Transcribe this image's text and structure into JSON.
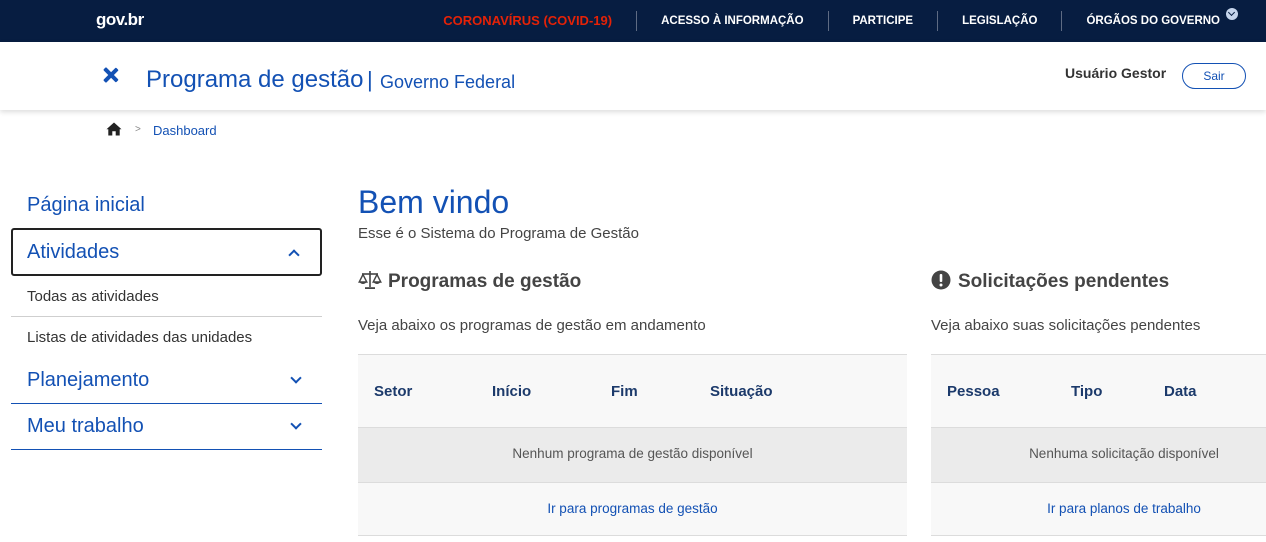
{
  "topbar": {
    "logo": "gov.br",
    "links": [
      "CORONAVÍRUS (COVID-19)",
      "ACESSO À INFORMAÇÃO",
      "PARTICIPE",
      "LEGISLAÇÃO",
      "ÓRGÃOS DO GOVERNO"
    ],
    "accent": "#e52207",
    "background": "#071d41"
  },
  "header": {
    "title": "Programa de gestão",
    "separator": "|",
    "subtitle": "Governo Federal",
    "user": "Usuário Gestor",
    "logout_label": "Sair",
    "brand_color": "#1351b4"
  },
  "breadcrumb": {
    "home_icon": "home-icon",
    "separator": ">",
    "current": "Dashboard"
  },
  "sidebar": {
    "home": "Página inicial",
    "atividades": {
      "label": "Atividades",
      "items": [
        "Todas as atividades",
        "Listas de atividades das unidades"
      ]
    },
    "planejamento": "Planejamento",
    "meu_trabalho": "Meu trabalho"
  },
  "main": {
    "title": "Bem vindo",
    "subtitle": "Esse é o Sistema do Programa de Gestão",
    "programas": {
      "icon": "balance-scale-icon",
      "title": "Programas de gestão",
      "description": "Veja abaixo os programas de gestão em andamento",
      "columns": [
        "Setor",
        "Início",
        "Fim",
        "Situação"
      ],
      "empty": "Nenhum programa de gestão disponível",
      "link": "Ir para programas de gestão"
    },
    "solicitacoes": {
      "icon": "exclamation-circle-icon",
      "title": "Solicitações pendentes",
      "description": "Veja abaixo suas solicitações pendentes",
      "columns": [
        "Pessoa",
        "Tipo",
        "Data"
      ],
      "empty": "Nenhuma solicitação disponível",
      "link": "Ir para planos de trabalho"
    }
  }
}
